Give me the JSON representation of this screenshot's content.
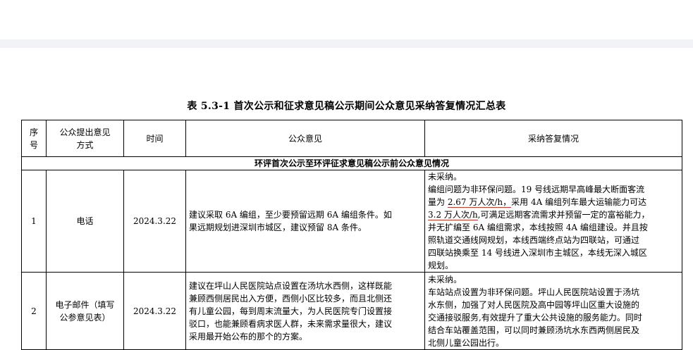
{
  "title": "表 5.3-1  首次公示和征求意见稿公示期间公众意见采纳答复情况汇总表",
  "headers": {
    "index_line1": "序",
    "index_line2": "号",
    "method_line1": "公众提出意见",
    "method_line2": "方式",
    "time": "时间",
    "opinion": "公众意见",
    "reply": "采纳答复情况"
  },
  "section_title": "环评首次公示至环评征求意见稿公示前公众意见情况",
  "rows": [
    {
      "index": "1",
      "method_line1": "电话",
      "method_line2": "",
      "time": "2024.3.22",
      "opinion_lines": [
        "建议采取 6A 编组，至少要预留远期 6A 编组条件。如",
        "果远期规划进深圳市城区，建议预留 8A 条件。"
      ],
      "reply_status": "未采纳。",
      "reply_l1": "编组问题为非环保问题。19 号线远期早高峰最大断面客流",
      "reply_l2a": "量为 ",
      "reply_l2_underlined": "2.67 万人次/h，",
      "reply_l2b": "采用 4A 编组列车最大运输能力可达",
      "reply_l3_underlined": "3.2 万人次/h",
      "reply_l3b": ",可满足远期客流需求并预留一定的富裕能力，",
      "reply_more": [
        "并无扩编至 6A 编组需求，本线按照 4A 编组建设。并且按",
        "照轨道交通线网规划，本线西端终点站为四联站，可通过",
        "四联站换乘至 14 号线进入深圳市主城区，本线无深入城区",
        "规划。"
      ]
    },
    {
      "index": "2",
      "method_line1": "电子邮件（填写",
      "method_line2": "公参意见表）",
      "time": "2024.3.22",
      "opinion_lines": [
        "建议在坪山人民医院站点设置在汤坑水西侧，这样既能",
        "兼顾西侧居民出入方便，西侧小区比较多，而且北侧还",
        "有儿童公园，每到周末流量大，为人民医院专门设置接",
        "驳口，也能兼顾看病求医人群，未来需求量很大，建议",
        "采用最开始公布的那个的方案。"
      ],
      "reply_status": "未采纳。",
      "reply_lines": [
        "车站站点设置为非环保问题。坪山人民医院站设置于汤坑",
        "水东侧，加强了对人民医院及高中园等坪山区重大设施的",
        "交通接驳服务,有效提升了重大公共设施的服务能力。同时",
        "结合车站覆盖范围，可以同时兼顾汤坑水东西两侧居民及",
        "北侧儿童公园出行。"
      ]
    }
  ]
}
